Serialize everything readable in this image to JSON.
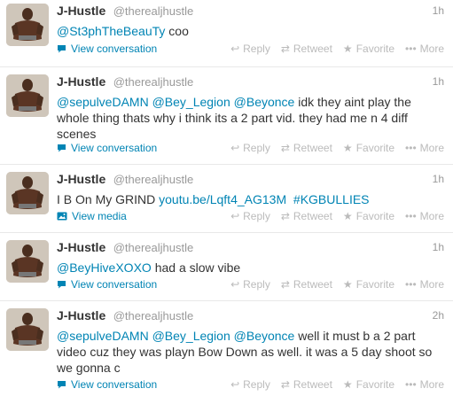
{
  "tweets": [
    {
      "name": "J-Hustle",
      "handle": "@therealjhustle",
      "time": "1h",
      "mention1": "@St3phTheBeauTy",
      "rest": " coo",
      "expand_label": "View conversation"
    },
    {
      "name": "J-Hustle",
      "handle": "@therealjhustle",
      "time": "1h",
      "mention1": "@sepulveDAMN",
      "mention2": "@Bey_Legion",
      "mention3": "@Beyonce",
      "rest": " idk they aint play the whole thing thats why i think its a 2 part vid. they had me n 4 diff scenes",
      "expand_label": "View conversation"
    },
    {
      "name": "J-Hustle",
      "handle": "@therealjhustle",
      "time": "1h",
      "prefix": "I B On My GRIND ",
      "link": "youtu.be/Lqft4_AG13M",
      "hashtag": "#KGBULLIES",
      "expand_label": "View media"
    },
    {
      "name": "J-Hustle",
      "handle": "@therealjhustle",
      "time": "1h",
      "mention1": "@BeyHiveXOXO",
      "rest": " had a slow vibe",
      "expand_label": "View conversation"
    },
    {
      "name": "J-Hustle",
      "handle": "@therealjhustle",
      "time": "2h",
      "mention1": "@sepulveDAMN",
      "mention2": "@Bey_Legion",
      "mention3": "@Beyonce",
      "rest": " well it must b a 2 part video cuz they was playn Bow Down as well. it was a 5 day shoot so we gonna c",
      "expand_label": "View conversation"
    }
  ],
  "actions": {
    "reply": "Reply",
    "retweet": "Retweet",
    "favorite": "Favorite",
    "more": "More"
  },
  "colors": {
    "link": "#0084b4",
    "muted": "#999999",
    "action": "#bbbbbb",
    "divider": "#e8e8e8"
  },
  "icons": {
    "expand_conversation": "speech-bubble-icon",
    "expand_media": "photo-icon",
    "reply": "reply-arrow-icon",
    "retweet": "retweet-icon",
    "favorite": "star-icon",
    "more": "dots-icon"
  }
}
